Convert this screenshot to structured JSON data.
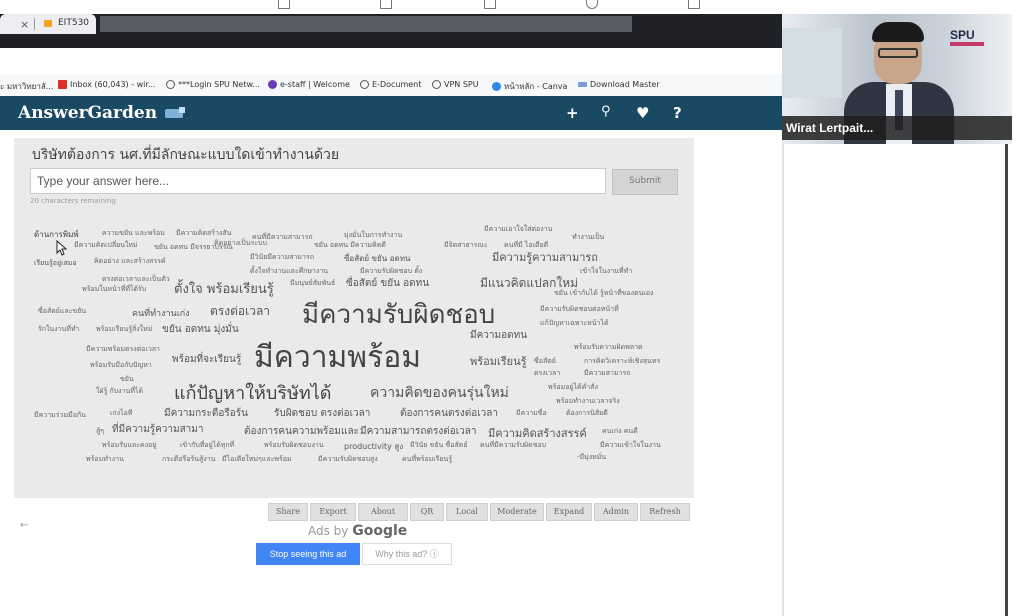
{
  "browser": {
    "tab_label": "EIT530",
    "tab_close": "×",
    "bookmarks": [
      {
        "label": "ะ มหาวิทยาลั...",
        "color": "#ffffff"
      },
      {
        "label": "Inbox (60,043) - wir...",
        "color": "#d93025"
      },
      {
        "label": "***Login SPU Netw...",
        "color": "#555555"
      },
      {
        "label": "e-staff | Welcome",
        "color": "#6a3bb5"
      },
      {
        "label": "E-Document",
        "color": "#555555"
      },
      {
        "label": "VPN SPU",
        "color": "#555555"
      },
      {
        "label": "หน้าหลัก - Canva",
        "color": "#2d8ae6"
      },
      {
        "label": "Download Master",
        "color": "#7a9ad0"
      }
    ]
  },
  "app": {
    "title": "AnswerGarden",
    "icons": [
      "plus-icon",
      "search-icon",
      "heart-icon",
      "help-icon"
    ],
    "icon_glyphs": {
      "plus": "+",
      "search": "⚲",
      "heart": "♥",
      "help": "?"
    },
    "brand_color": "#1a4a63"
  },
  "garden": {
    "question": "บริษัทต้องการ นศ.ที่มีลักษณะแบบใดเข้าทำงานด้วย",
    "placeholder": "Type your answer here...",
    "submit_label": "Submit",
    "chars_remaining": "20 characters remaining",
    "words": [
      {
        "t": "ด้านการพิมพ์",
        "s": 8,
        "c": "#444"
      },
      {
        "t": "ความขยัน และพร้อม",
        "s": 7,
        "c": "#666"
      },
      {
        "t": "มีความคิดสร้างสัน",
        "s": 7,
        "c": "#666"
      },
      {
        "t": "คนที่มีความสามารถ",
        "s": 7,
        "c": "#666"
      },
      {
        "t": "มุ่งมั่นในการทำงาน",
        "s": 7,
        "c": "#666"
      },
      {
        "t": "มีความเอาใจใส่ต่องาน",
        "s": 7,
        "c": "#666"
      },
      {
        "t": "ทำงานเป็น",
        "s": 7,
        "c": "#666"
      },
      {
        "t": "มีความคิดเปลี่ยนใหม่",
        "s": 7,
        "c": "#666"
      },
      {
        "t": "ขยัน อดทน มีจรรยาบรรณ",
        "s": 7,
        "c": "#666"
      },
      {
        "t": "คิดอย่างเป็นระบบ",
        "s": 7,
        "c": "#666"
      },
      {
        "t": "ขยัน อดทน มีความคิดดี",
        "s": 7,
        "c": "#666"
      },
      {
        "t": "มีจิตสาธารณะ",
        "s": 7,
        "c": "#666"
      },
      {
        "t": "คนที่มี ไอเดียดี",
        "s": 7,
        "c": "#666"
      },
      {
        "t": "เรียนรู้อยู่เสมอ",
        "s": 7,
        "c": "#555"
      },
      {
        "t": "คิดอย่าง และสร้างสรรค์",
        "s": 7,
        "c": "#666"
      },
      {
        "t": "มีวินัยมีความสามารถ",
        "s": 7,
        "c": "#666"
      },
      {
        "t": "ซื่อสัตย์ ขยัน อดทน",
        "s": 8,
        "c": "#555"
      },
      {
        "t": "มีความรู้ความสามารถ",
        "s": 11,
        "c": "#555"
      },
      {
        "t": "ตั้งใจทำงานและศึกษางาน",
        "s": 7,
        "c": "#666"
      },
      {
        "t": "มีความรับผิดชอบ ตั้ง",
        "s": 7,
        "c": "#666"
      },
      {
        "t": "เข้าใจในงานที่ทำ",
        "s": 7,
        "c": "#666"
      },
      {
        "t": "ตรงต่อเวลาและเป็นตัว",
        "s": 7,
        "c": "#666"
      },
      {
        "t": "พร้อมในหน้าที่ที่ได้รับ",
        "s": 7,
        "c": "#666"
      },
      {
        "t": "ตั้งใจ พร้อมเรียนรู้",
        "s": 13,
        "c": "#555"
      },
      {
        "t": "มีมนุษย์สัมพันธ์",
        "s": 7,
        "c": "#666"
      },
      {
        "t": "ซื่อสัตย์ ขยัน อดทน",
        "s": 10,
        "c": "#555"
      },
      {
        "t": "มีแนวคิดแปลกใหม่",
        "s": 12,
        "c": "#555"
      },
      {
        "t": "ขยัน เข้ากับได้ รู้หน้าที่ของตนเอง",
        "s": 7,
        "c": "#666"
      },
      {
        "t": "ซื่อสัตย์และขยัน",
        "s": 7,
        "c": "#666"
      },
      {
        "t": "คนที่ทำงานเก่ง",
        "s": 9,
        "c": "#555"
      },
      {
        "t": "ตรงต่อเวลา",
        "s": 12,
        "c": "#555"
      },
      {
        "t": "มีความรับผิดชอบ",
        "s": 26,
        "c": "#444"
      },
      {
        "t": "มีความรับผิดชอบต่อหน้าที่",
        "s": 7,
        "c": "#666"
      },
      {
        "t": "รักในงานที่ทำ",
        "s": 7,
        "c": "#666"
      },
      {
        "t": "พร้อมเรียนรู้สิ่งใหม่",
        "s": 7,
        "c": "#666"
      },
      {
        "t": "ขยัน อดทน มุ่งมั่น",
        "s": 10,
        "c": "#555"
      },
      {
        "t": "แก้ปัญหาเฉพาะหน้าได้",
        "s": 7,
        "c": "#666"
      },
      {
        "t": "มีความอดทน",
        "s": 10,
        "c": "#555"
      },
      {
        "t": "มีความพร้อมตรงต่อเวลา",
        "s": 7,
        "c": "#666"
      },
      {
        "t": "พร้อมรับความผิดพลาด",
        "s": 7,
        "c": "#666"
      },
      {
        "t": "มีความพร้อม",
        "s": 30,
        "c": "#444"
      },
      {
        "t": "พร้อมที่จะเรียนรู้",
        "s": 10,
        "c": "#555"
      },
      {
        "t": "พร้อมรับมือกับปัญหา",
        "s": 7,
        "c": "#666"
      },
      {
        "t": "พร้อมเรียนรู้",
        "s": 11,
        "c": "#555"
      },
      {
        "t": "ซื่อสัตย์",
        "s": 7,
        "c": "#666"
      },
      {
        "t": "การคิดวิเคราะห์เชิงสุนทร",
        "s": 7,
        "c": "#666"
      },
      {
        "t": "ตรงเวลา",
        "s": 7,
        "c": "#666"
      },
      {
        "t": "มีความสามารถ",
        "s": 7,
        "c": "#666"
      },
      {
        "t": "ขยัน",
        "s": 7,
        "c": "#666"
      },
      {
        "t": "ใฝ่รู้ กับงานที่ได้",
        "s": 7,
        "c": "#666"
      },
      {
        "t": "แก้ปัญหาให้บริษัทได้",
        "s": 18,
        "c": "#444"
      },
      {
        "t": "ความคิดของคนรุ่นใหม่",
        "s": 14,
        "c": "#555"
      },
      {
        "t": "พร้อมอยู่ได้ค่ำสั่ง",
        "s": 7,
        "c": "#666"
      },
      {
        "t": "พร้อมทำงานเวลาจริง",
        "s": 7,
        "c": "#666"
      },
      {
        "t": "มีความกระตือรือร้น",
        "s": 10,
        "c": "#555"
      },
      {
        "t": "รับผิดชอบ ตรงต่อเวลา",
        "s": 10,
        "c": "#555"
      },
      {
        "t": "ต้องการคนตรงต่อเวลา",
        "s": 10,
        "c": "#555"
      },
      {
        "t": "มีความซื่อ",
        "s": 7,
        "c": "#666"
      },
      {
        "t": "ต้องการนิสัยดี",
        "s": 7,
        "c": "#666"
      },
      {
        "t": "มีความร่วมมือกัน",
        "s": 7,
        "c": "#666"
      },
      {
        "t": "เก่งไอที",
        "s": 7,
        "c": "#666"
      },
      {
        "t": "สู้ๆ",
        "s": 7,
        "c": "#666"
      },
      {
        "t": "ที่มีความรู้ความสามา",
        "s": 10,
        "c": "#555"
      },
      {
        "t": "ต้องการคนความพร้อมและ",
        "s": 10,
        "c": "#555"
      },
      {
        "t": "มีความสามารถตรงต่อเวลา",
        "s": 10,
        "c": "#555"
      },
      {
        "t": "มีความคิดสร้างสรรค์",
        "s": 11,
        "c": "#555"
      },
      {
        "t": "คนเก่ง คนดี",
        "s": 7,
        "c": "#666"
      },
      {
        "t": "พร้อมรับและคงอยู่",
        "s": 7,
        "c": "#666"
      },
      {
        "t": "เข้ากับที่อยู่ได้ทุกที่",
        "s": 7,
        "c": "#666"
      },
      {
        "t": "พร้อมรับผิดชอบงาน",
        "s": 7,
        "c": "#666"
      },
      {
        "t": "productivity สูง",
        "s": 8,
        "c": "#555"
      },
      {
        "t": "มีวินัย ขยัน ซื่อสัตย์",
        "s": 7,
        "c": "#666"
      },
      {
        "t": "คนที่มีความรับผิดชอบ",
        "s": 7,
        "c": "#666"
      },
      {
        "t": "มีความเข้าใจในงาน",
        "s": 7,
        "c": "#666"
      },
      {
        "t": "พร้อมทำงาน",
        "s": 7,
        "c": "#666"
      },
      {
        "t": "กระตือรือร้นสู้งาน",
        "s": 7,
        "c": "#666"
      },
      {
        "t": "มีไอเดียใหม่ๆและพร้อม",
        "s": 7,
        "c": "#666"
      },
      {
        "t": "มีความรับผิดชอบสูง",
        "s": 7,
        "c": "#666"
      },
      {
        "t": "คนที่พร้อมเรียนรู้",
        "s": 7,
        "c": "#666"
      },
      {
        "t": "-มีมุ่งหมั่น",
        "s": 7,
        "c": "#666"
      }
    ],
    "buttons": [
      "Share",
      "Export",
      "About",
      "QR",
      "Local",
      "Moderate",
      "Expand",
      "Admin",
      "Refresh"
    ]
  },
  "ads": {
    "ads_by": "Ads by",
    "google": "Google",
    "stop_label": "Stop seeing this ad",
    "why_label": "Why this ad? ⓘ"
  },
  "video": {
    "name": "Wirat Lertpait...",
    "logo": "SPU"
  }
}
